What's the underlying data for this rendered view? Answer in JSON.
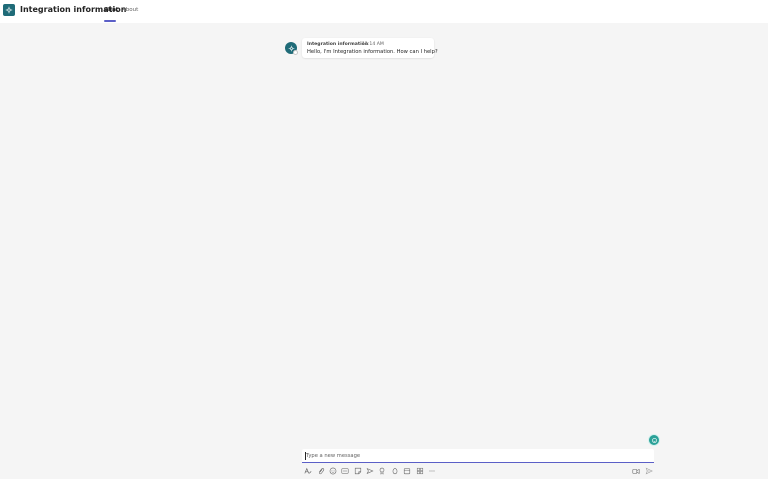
{
  "header": {
    "app_title": "Integration information",
    "tabs": [
      {
        "label": "Chat",
        "active": true
      },
      {
        "label": "About",
        "active": false
      }
    ]
  },
  "message": {
    "sender": "Integration information",
    "time": "11:14 AM",
    "text": "Hello, I'm Integration information. How can I help?"
  },
  "compose": {
    "placeholder": "Type a new message"
  },
  "toolbar": {
    "icons": [
      "format-icon",
      "attach-icon",
      "emoji-icon",
      "gif-icon",
      "sticker-icon",
      "schedule-meeting-icon",
      "praise-icon",
      "loop-icon",
      "apps-icon",
      "more-options-icon"
    ]
  },
  "colors": {
    "accent": "#5b5fc7",
    "app_tile": "#1f6b78",
    "fab": "#2aa198",
    "background": "#f5f5f5"
  }
}
